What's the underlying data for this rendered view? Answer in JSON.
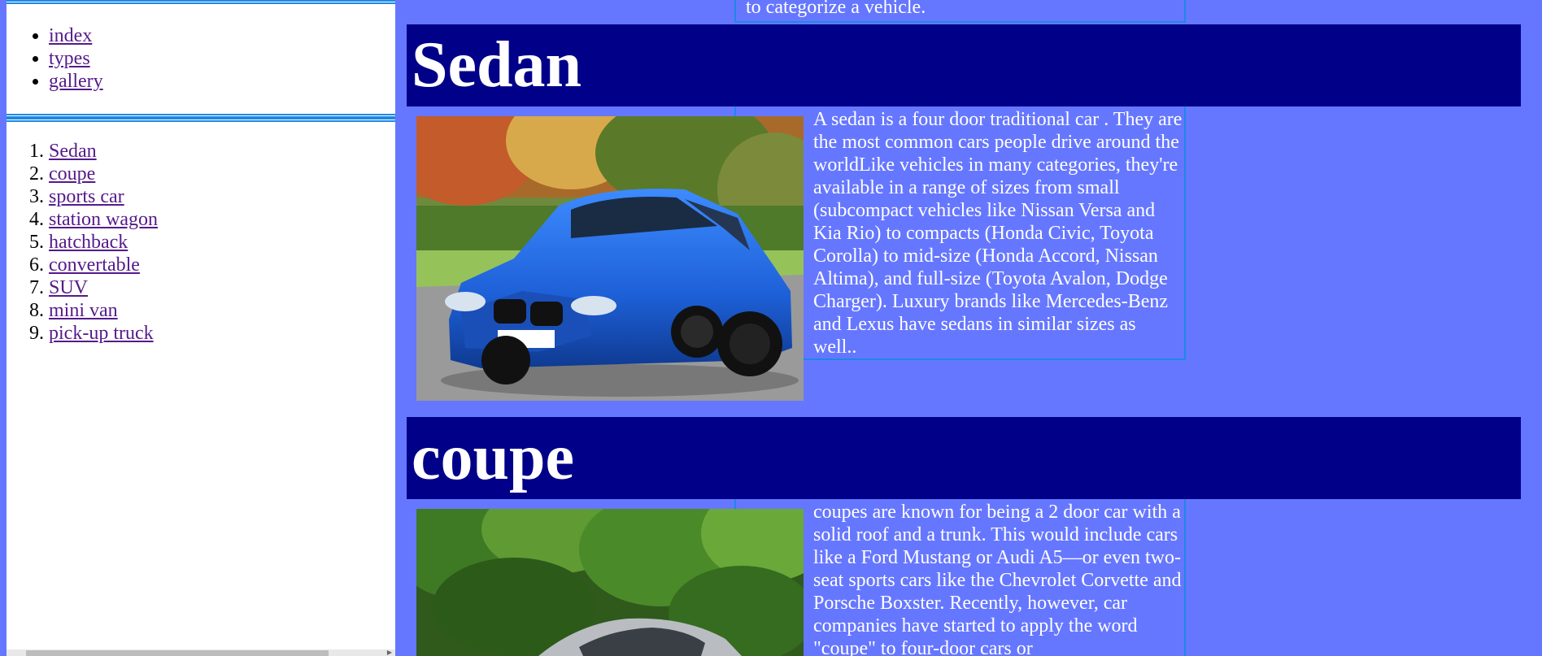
{
  "nav": {
    "items": [
      {
        "label": "index"
      },
      {
        "label": "types"
      },
      {
        "label": "gallery"
      }
    ]
  },
  "types_menu": {
    "items": [
      {
        "label": "Sedan"
      },
      {
        "label": "coupe"
      },
      {
        "label": "sports car"
      },
      {
        "label": "station wagon"
      },
      {
        "label": "hatchback"
      },
      {
        "label": "convertable"
      },
      {
        "label": "SUV"
      },
      {
        "label": "mini van"
      },
      {
        "label": "pick-up truck"
      }
    ]
  },
  "intro": {
    "tail_text": "to categorize a vehicle."
  },
  "sections": [
    {
      "title": "Sedan",
      "image_icon": "blue-sedan-photo",
      "description": "A sedan is a four door traditional car . They are the most common cars people drive around the worldLike vehicles in many categories, they're available in a range of sizes from small (subcompact vehicles like Nissan Versa and Kia Rio) to compacts (Honda Civic, Toyota Corolla) to mid-size (Honda Accord, Nissan Altima), and full-size (Toyota Avalon, Dodge Charger). Luxury brands like Mercedes-Benz and Lexus have sedans in similar sizes as well.."
    },
    {
      "title": "coupe",
      "image_icon": "silver-coupe-photo",
      "description": "coupes are known for being a 2 door car with a solid roof and a trunk. This would include cars like a Ford Mustang or Audi A5—or even two-seat sports cars like the Chevrolet Corvette and Porsche Boxster. Recently, however, car companies have started to apply the word \"coupe\" to four-door cars or"
    }
  ],
  "colors": {
    "page_background": "#6677ff",
    "header_background": "#000088",
    "frame_border": "#1e88e5",
    "link_visited": "#551a8b"
  }
}
